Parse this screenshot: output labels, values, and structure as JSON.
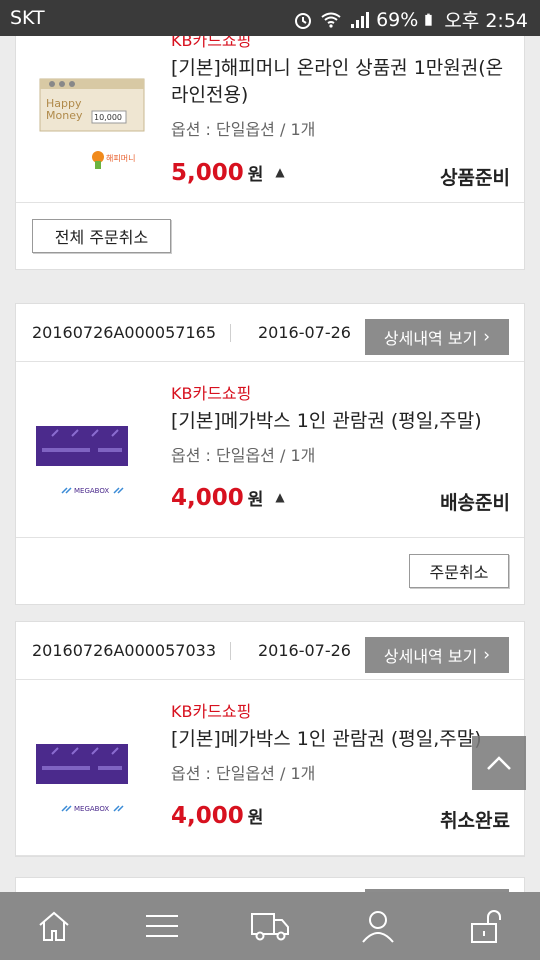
{
  "status_bar": {
    "carrier": "SKT",
    "battery": "69%",
    "time": "오후 2:54"
  },
  "orders": [
    {
      "items": [
        {
          "shop": "KB카드쇼핑",
          "name": "[기본]해피머니 온라인 상품권 1만원권(온라인전용)",
          "option": "옵션 : 단일옵션 / 1개",
          "price": "5,000",
          "currency": "원",
          "status": "상품준비",
          "thumbnail": "happymoney-giftcard-image"
        }
      ],
      "cancel_label": "전체 주문취소"
    },
    {
      "order_no": "20160726A000057165",
      "date": "2016-07-26",
      "detail_label": "상세내역 보기",
      "items": [
        {
          "shop": "KB카드쇼핑",
          "name": "[기본]메가박스 1인 관람권 (평일,주말)",
          "option": "옵션 : 단일옵션 / 1개",
          "price": "4,000",
          "currency": "원",
          "status": "배송준비",
          "thumbnail": "megabox-ticket-image"
        }
      ],
      "cancel_label": "주문취소"
    },
    {
      "order_no": "20160726A000057033",
      "date": "2016-07-26",
      "detail_label": "상세내역 보기",
      "items": [
        {
          "shop": "KB카드쇼핑",
          "name": "[기본]메가박스 1인 관람권 (평일,주말)",
          "option": "옵션 : 단일옵션 / 1개",
          "price": "4,000",
          "currency": "원",
          "status": "취소완료",
          "thumbnail": "megabox-ticket-image"
        }
      ]
    }
  ],
  "bottom_nav": [
    "home-icon",
    "menu-icon",
    "delivery-truck-icon",
    "user-icon",
    "unlock-icon"
  ],
  "colors": {
    "accent_red": "#d7111f",
    "nav_bg": "#8a8a8a",
    "statusbar_bg": "#3a3a3a"
  }
}
